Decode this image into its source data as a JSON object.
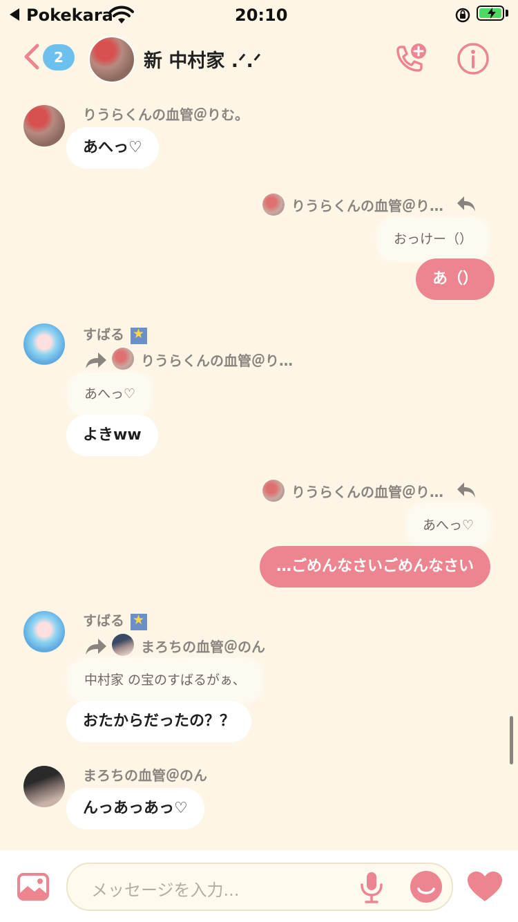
{
  "status_bar": {
    "back_app": "Pokekara",
    "time": "20:10"
  },
  "header": {
    "unread_count": "2",
    "title": "新 中村家 .ᐟ.ᐟ"
  },
  "messages": [
    {
      "sender": "りうらくんの血管＠りむ。",
      "text": "あへっ♡"
    },
    {
      "reply_to": "りうらくんの血管＠り…",
      "quote": "おっけー（）",
      "text": "あ（）"
    },
    {
      "sender": "すばる",
      "sender_emoji": "🌟",
      "reply_to": "りうらくんの血管＠り…",
      "quote": "あへっ♡",
      "text": "よきww"
    },
    {
      "reply_to": "りうらくんの血管＠り…",
      "quote": "あへっ♡",
      "text": "…ごめんなさいごめんなさい"
    },
    {
      "sender": "すばる",
      "sender_emoji": "🌟",
      "reply_to": "まろちの血管＠のん",
      "quote": "中村家 の宝のすばるがぁ、",
      "text": "おたからだったの？？"
    },
    {
      "sender": "まろちの血管＠のん",
      "text": "んっあっあっ♡"
    }
  ],
  "composer": {
    "placeholder": "メッセージを入力..."
  },
  "colors": {
    "background": "#fdf6e6",
    "accent_pink": "#ec8590",
    "badge_blue": "#6cc0ee"
  }
}
